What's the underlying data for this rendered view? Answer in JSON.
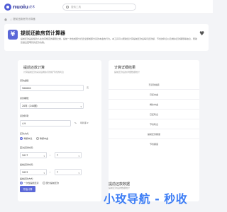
{
  "brand": {
    "name": "nuoiu",
    "sub": "虎术"
  },
  "search": {
    "placeholder": "搜索工具"
  },
  "breadcrumb": {
    "home": "",
    "sep": "/",
    "current": "提前还款房贷计算器"
  },
  "hero": {
    "title": "提前还款房贷计算器",
    "description": "提前还款是指借款人在合同规定的期限之前，提前一次性或部分归还全部或部分贷款本金的行为。本工具可以帮助您计算提前还款后每月还款额、节省的利息以及剩余还款期限等信息，帮助您做出更明智的还款决策。"
  },
  "form": {
    "title": "提前还款计算",
    "subtitle": "计算提前还款房贷后剩余月供和节省的利息",
    "loan_amount": {
      "label": "贷款金额：",
      "value": "500000",
      "unit": "元"
    },
    "loan_term": {
      "label": "贷款期限：",
      "value": "20年（240期）"
    },
    "rate": {
      "label": "贷款利率：",
      "value": "4.9",
      "unit": "%",
      "rate_type": "年利率"
    },
    "repay_method": {
      "label": "还款方式：",
      "options": [
        "等额本息",
        "等额本金"
      ],
      "selected": 0
    },
    "first_date": {
      "label": "首次还款时间：",
      "year": "2017",
      "month": "7",
      "sep": "—"
    },
    "prepay_date": {
      "label": "提前还款时间：",
      "year": "2023",
      "month": "7",
      "sep": "—"
    },
    "prepay_method": {
      "label": "提前还款方式：",
      "options": [
        "一次性提前还清",
        "部分提前还款"
      ],
      "selected": 0
    },
    "button": "开始计算"
  },
  "results": {
    "title": "计算详细结果",
    "subtitle": "提前还款后的详细数据统计",
    "rows": [
      "已还款总额",
      "已还本金",
      "剩余本金",
      "已还利息",
      "节省利息",
      "提前还款额度",
      "节省额度"
    ]
  },
  "details": {
    "title": "提前还款数据",
    "subtitle": "提前还款后的数据统计"
  },
  "watermark": "小玫导航 - 秒收"
}
